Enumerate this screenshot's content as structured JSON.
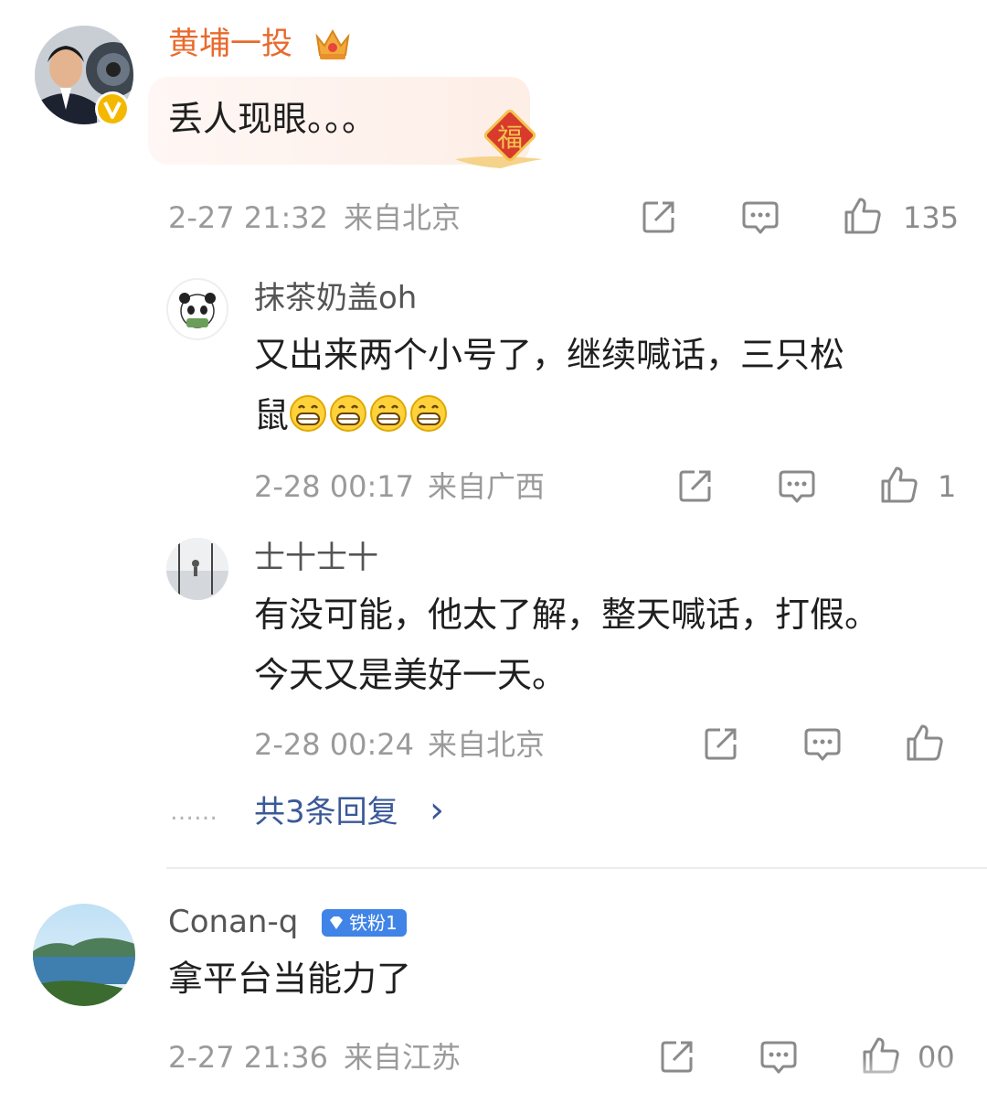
{
  "comments": [
    {
      "username": "黄埔一投",
      "text": "丢人现眼。。。",
      "time": "2-27 21:32",
      "location": "来自北京",
      "likes": "135",
      "colors": {
        "name": "#e86a2c"
      }
    },
    {
      "username": "Conan-q",
      "badge": "铁粉1",
      "text": "拿平台当能力了",
      "time": "2-27 21:36",
      "location": "来自江苏",
      "likes": "00",
      "colors": {
        "badge_bg": "#3f84e6"
      }
    }
  ],
  "replies": [
    {
      "username": "抹茶奶盖oh",
      "text_line1": "又出来两个小号了，继续喊话，三只松",
      "text_line2": "鼠",
      "emoji_count": 4,
      "time": "2-28 00:17",
      "location": "来自广西",
      "likes": "1"
    },
    {
      "username": "士十士十",
      "text_line1": "有没可能，他太了解，整天喊话，打假。",
      "text_line2": "今天又是美好一天。",
      "time": "2-28 00:24",
      "location": "来自北京",
      "likes": ""
    }
  ],
  "more_replies": {
    "dots": "……",
    "label": "共3条回复",
    "arrow": "›",
    "color": "#3b5998"
  },
  "icons": [
    "crown-icon",
    "verified-icon",
    "fu-badge-icon",
    "share-icon",
    "comment-icon",
    "like-icon",
    "grin-emoji-icon",
    "diamond-icon"
  ]
}
